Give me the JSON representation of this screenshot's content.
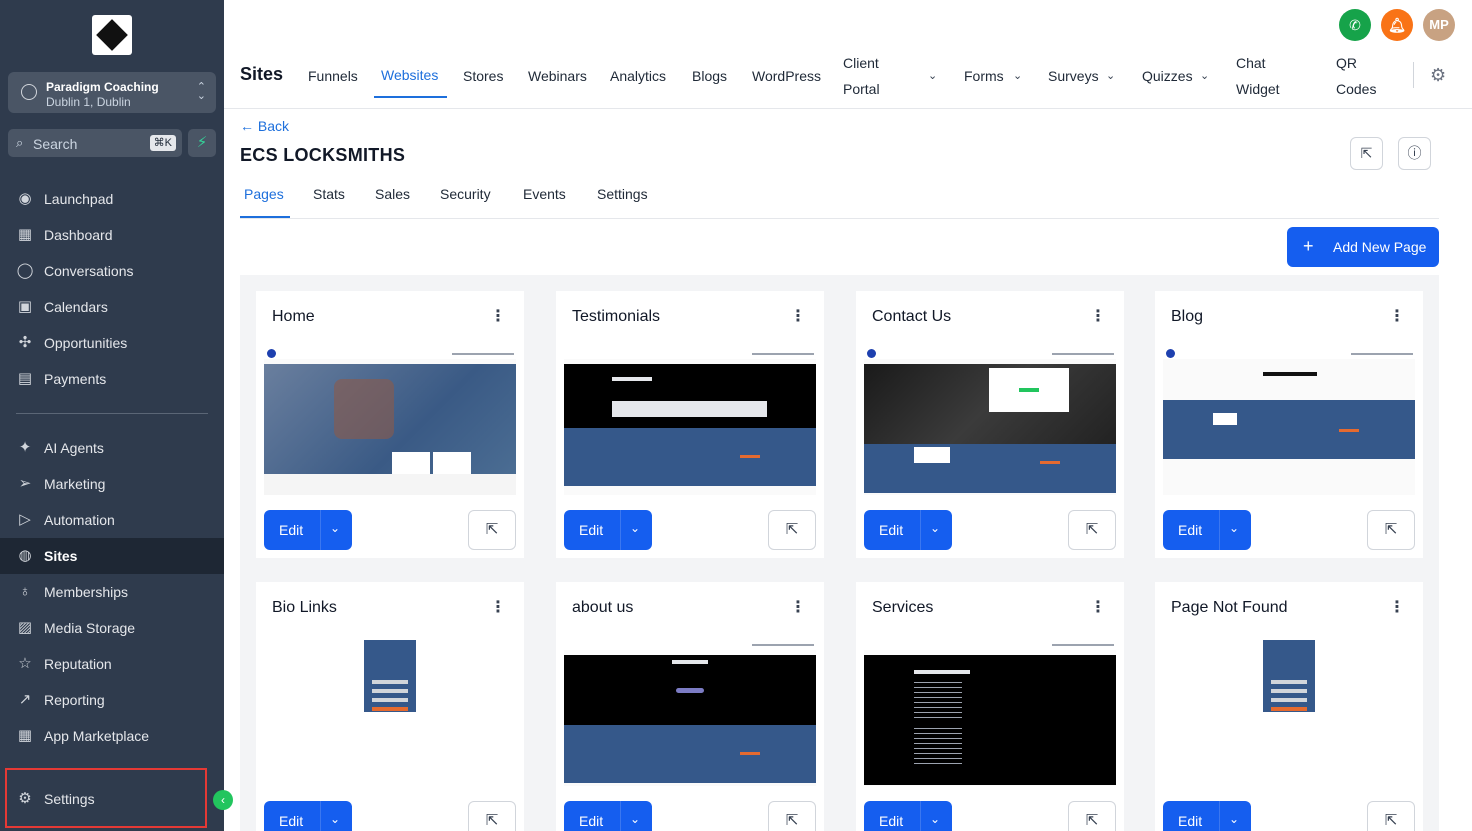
{
  "sidebar": {
    "account": {
      "name": "Paradigm Coaching",
      "location": "Dublin 1, Dublin"
    },
    "search": {
      "placeholder": "Search",
      "shortcut": "⌘K"
    },
    "items": [
      {
        "label": "Launchpad",
        "icon": "rocket-icon",
        "glyph": "◉"
      },
      {
        "label": "Dashboard",
        "icon": "grid-icon",
        "glyph": "▦"
      },
      {
        "label": "Conversations",
        "icon": "chat-bubble-icon",
        "glyph": "◯"
      },
      {
        "label": "Calendars",
        "icon": "calendar-icon",
        "glyph": "▣"
      },
      {
        "label": "Opportunities",
        "icon": "network-icon",
        "glyph": "✣"
      },
      {
        "label": "Payments",
        "icon": "receipt-icon",
        "glyph": "▤"
      },
      {
        "label": "AI Agents",
        "icon": "sparkle-icon",
        "glyph": "✦"
      },
      {
        "label": "Marketing",
        "icon": "send-icon",
        "glyph": "➢"
      },
      {
        "label": "Automation",
        "icon": "play-circle-icon",
        "glyph": "▷"
      },
      {
        "label": "Sites",
        "icon": "globe-icon",
        "glyph": "◍"
      },
      {
        "label": "Memberships",
        "icon": "badge-icon",
        "glyph": "♁"
      },
      {
        "label": "Media Storage",
        "icon": "image-icon",
        "glyph": "▨"
      },
      {
        "label": "Reputation",
        "icon": "star-icon",
        "glyph": "☆"
      },
      {
        "label": "Reporting",
        "icon": "trend-icon",
        "glyph": "↗"
      },
      {
        "label": "App Marketplace",
        "icon": "apps-icon",
        "glyph": "▦"
      }
    ],
    "active": "Sites",
    "settings_label": "Settings"
  },
  "topbar": {
    "title": "Sites",
    "tabs": [
      "Funnels",
      "Websites",
      "Stores",
      "Webinars",
      "Analytics",
      "Blogs",
      "WordPress"
    ],
    "client_portal": [
      "Client",
      "Portal"
    ],
    "dropdowns": [
      "Forms",
      "Surveys",
      "Quizzes"
    ],
    "chat_widget": [
      "Chat",
      "Widget"
    ],
    "qr_codes": [
      "QR",
      "Codes"
    ],
    "active_tab": "Websites",
    "avatar_initials": "MP"
  },
  "site": {
    "back_label": "Back",
    "title": "ECS LOCKSMITHS",
    "tabs": [
      "Pages",
      "Stats",
      "Sales",
      "Security",
      "Events",
      "Settings"
    ],
    "active_tab": "Pages",
    "add_page_label": "Add New Page"
  },
  "pages": [
    {
      "title": "Home"
    },
    {
      "title": "Testimonials"
    },
    {
      "title": "Contact Us"
    },
    {
      "title": "Blog"
    },
    {
      "title": "Bio Links"
    },
    {
      "title": "about us"
    },
    {
      "title": "Services"
    },
    {
      "title": "Page Not Found"
    }
  ],
  "card_labels": {
    "edit": "Edit"
  },
  "colors": {
    "primary": "#155eef",
    "sidebar": "#2f3b4d",
    "accent_green": "#22c55e",
    "bell_orange": "#f97316"
  }
}
